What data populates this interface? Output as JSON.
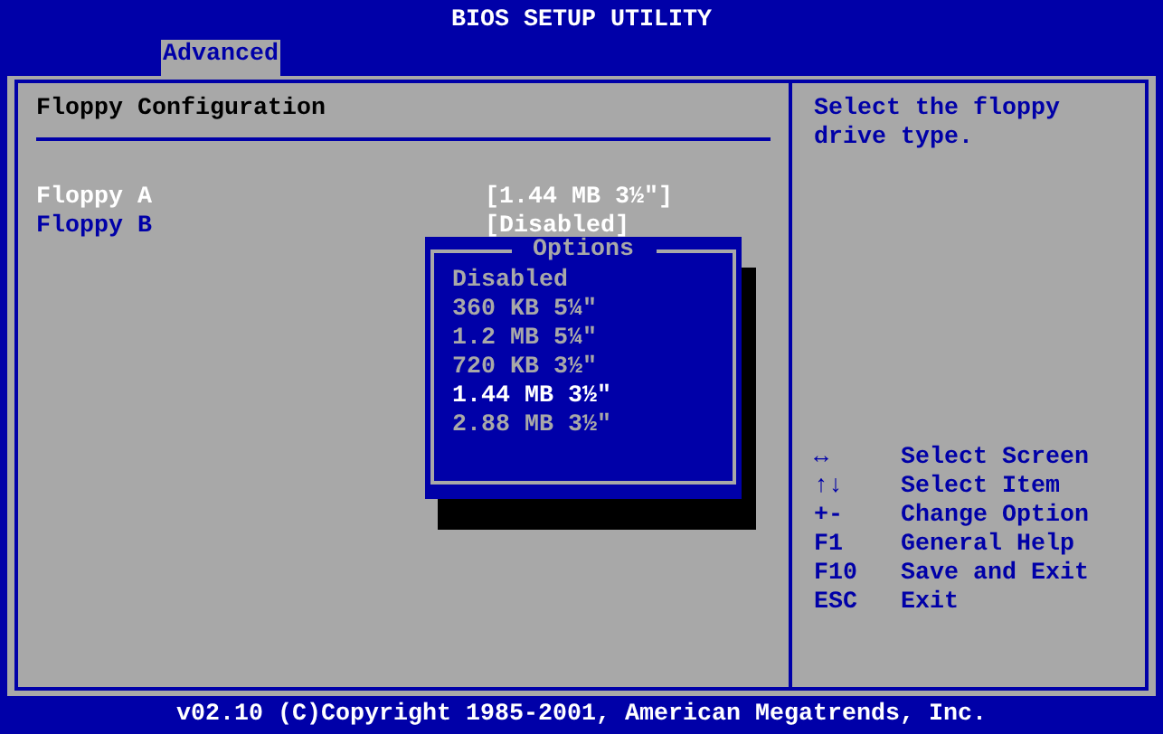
{
  "window": {
    "title": "BIOS SETUP UTILITY"
  },
  "tabs": [
    {
      "label": "Advanced",
      "selected": true
    }
  ],
  "settings": {
    "title": "Floppy Configuration",
    "items": [
      {
        "label": "Floppy A",
        "value": "[1.44 MB 3½\"]",
        "selected": true
      },
      {
        "label": "Floppy B",
        "value": "[Disabled]",
        "selected": false
      }
    ]
  },
  "help": {
    "text": "Select the floppy drive type.",
    "keys": [
      {
        "key": "↔",
        "action": "Select Screen"
      },
      {
        "key": "↑↓",
        "action": "Select Item"
      },
      {
        "key": "+-",
        "action": "Change Option"
      },
      {
        "key": "F1",
        "action": "General Help"
      },
      {
        "key": "F10",
        "action": "Save and Exit"
      },
      {
        "key": "ESC",
        "action": "Exit"
      }
    ]
  },
  "popup": {
    "title": "Options",
    "options": [
      {
        "label": "Disabled",
        "selected": false
      },
      {
        "label": "360 KB 5¼\"",
        "selected": false
      },
      {
        "label": "1.2 MB 5¼\"",
        "selected": false
      },
      {
        "label": "720 KB 3½\"",
        "selected": false
      },
      {
        "label": "1.44 MB 3½\"",
        "selected": true
      },
      {
        "label": "2.88 MB 3½\"",
        "selected": false
      }
    ]
  },
  "status_bar": "v02.10 (C)Copyright 1985-2001, American Megatrends, Inc."
}
